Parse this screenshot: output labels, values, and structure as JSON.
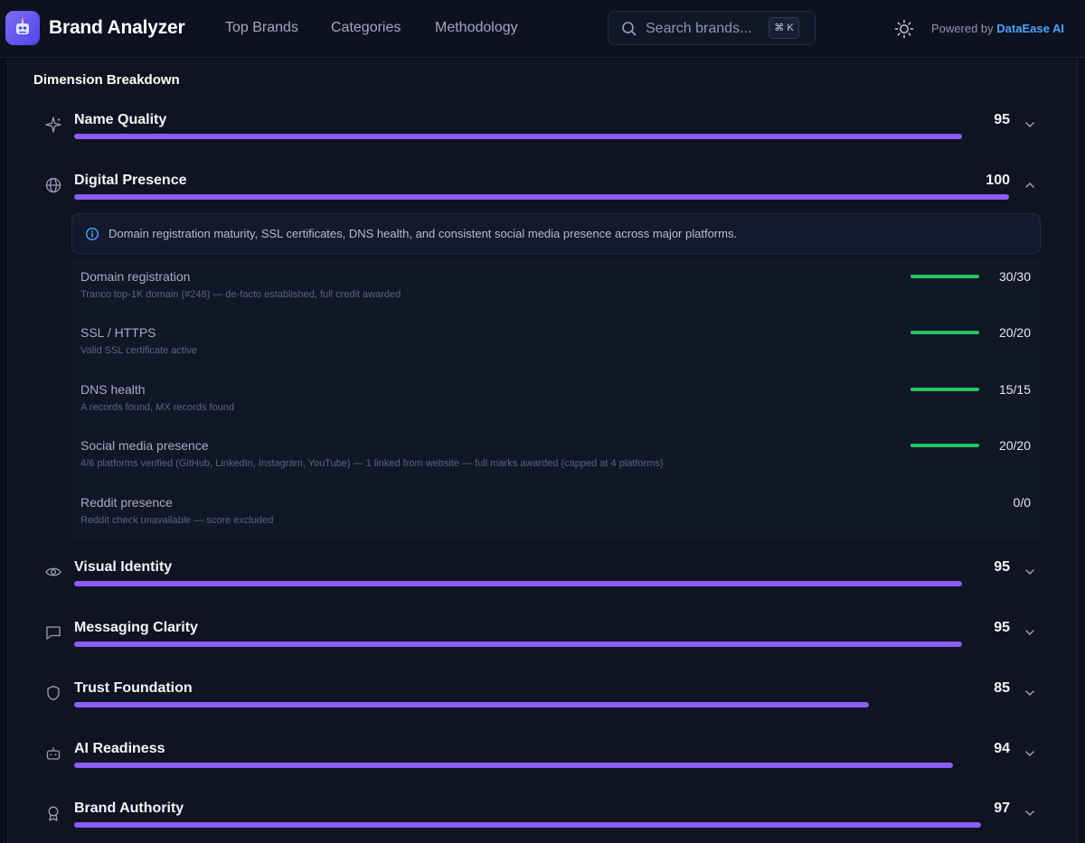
{
  "header": {
    "brand_name": "Brand Analyzer",
    "nav": [
      "Top Brands",
      "Categories",
      "Methodology"
    ],
    "search_placeholder": "Search brands...",
    "search_shortcut": "⌘ K",
    "powered_prefix": "Powered by",
    "powered_brand": "DataEase AI"
  },
  "section_title": "Dimension Breakdown",
  "colors": {
    "accent": "#8b5cf6",
    "success": "#22c55e",
    "link": "#4ea3ff",
    "background": "#0b0f1c"
  },
  "dimensions": [
    {
      "label": "Name Quality",
      "score": "95",
      "icon": "sparkle-icon",
      "value": 95,
      "expanded": false
    },
    {
      "label": "Digital Presence",
      "score": "100",
      "icon": "globe-icon",
      "value": 100,
      "expanded": true
    },
    {
      "label": "Visual Identity",
      "score": "95",
      "icon": "eye-icon",
      "value": 95,
      "expanded": false
    },
    {
      "label": "Messaging Clarity",
      "score": "95",
      "icon": "message-icon",
      "value": 95,
      "expanded": false
    },
    {
      "label": "Trust Foundation",
      "score": "85",
      "icon": "shield-icon",
      "value": 85,
      "expanded": false
    },
    {
      "label": "AI Readiness",
      "score": "94",
      "icon": "bot-icon",
      "value": 94,
      "expanded": false
    },
    {
      "label": "Brand Authority",
      "score": "97",
      "icon": "award-icon",
      "value": 97,
      "expanded": false
    }
  ],
  "digital_presence": {
    "info": "Domain registration maturity, SSL certificates, DNS health, and consistent social media presence across major platforms.",
    "items": [
      {
        "name": "Domain registration",
        "desc": "Tranco top-1K domain (#248) — de-facto established, full credit awarded",
        "score": "30/30",
        "fraction": 1
      },
      {
        "name": "SSL / HTTPS",
        "desc": "Valid SSL certificate active",
        "score": "20/20",
        "fraction": 1
      },
      {
        "name": "DNS health",
        "desc": "A records found, MX records found",
        "score": "15/15",
        "fraction": 1
      },
      {
        "name": "Social media presence",
        "desc": "4/6 platforms verified (GitHub, LinkedIn, Instagram, YouTube) — 1 linked from website — full marks awarded (capped at 4 platforms)",
        "score": "20/20",
        "fraction": 1
      },
      {
        "name": "Reddit presence",
        "desc": "Reddit check unavailable — score excluded",
        "score": "0/0",
        "fraction": null
      }
    ]
  }
}
